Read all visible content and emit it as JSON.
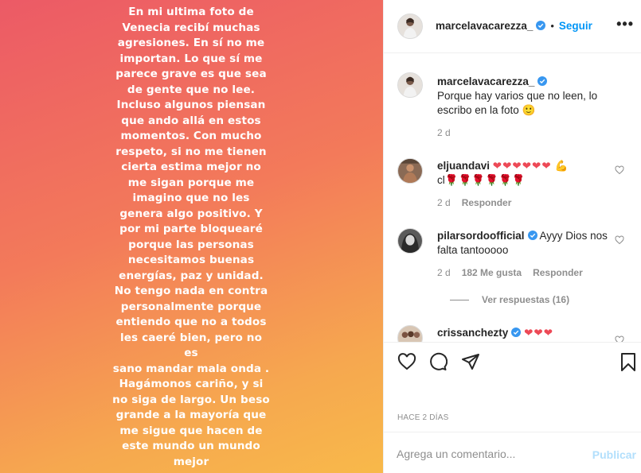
{
  "post": {
    "story_text": "En mi ultima foto de\nVenecia recibí muchas\nagresiones. En sí no me\nimportan. Lo que sí me\nparece grave es que sea\nde gente que no lee.\nIncluso algunos piensan\nque ando allá en estos\nmomentos. Con mucho\nrespeto, si no me tienen\ncierta estima mejor no\nme sigan porque me\nimagino que no les\ngenera algo positivo. Y\npor mi parte bloquearé\nporque las personas\nnecesitamos buenas\nenergías, paz y unidad.\nNo tengo nada en contra\npersonalmente porque\nentiendo que no a todos\nles caeré bien, pero no es\nsano mandar mala onda .\nHagámonos cariño, y si\nno siga de largo. Un beso\ngrande a la mayoría que\nme sigue que hacen de\neste mundo un mundo\nmejor"
  },
  "header": {
    "username": "marcelavacarezza_",
    "dot": "•",
    "follow_label": "Seguir",
    "menu": "•••"
  },
  "caption": {
    "username": "marcelavacarezza_",
    "text": "Porque hay varios que no leen, lo escribo en la foto 🙂",
    "time": "2 d"
  },
  "comments": [
    {
      "username": "eljuandavi",
      "text_hearts": "❤❤❤❤❤❤",
      "text_arm": "💪",
      "text_line2_prefix": "cl",
      "text_line2_roses": "🌹🌹🌹🌹🌹🌹",
      "time": "2 d",
      "reply_label": "Responder"
    },
    {
      "username": "pilarsordoofficial",
      "text": "Ayyy Dios nos falta tantooooo",
      "time": "2 d",
      "likes": "182 Me gusta",
      "reply_label": "Responder",
      "view_replies": "Ver respuestas (16)"
    },
    {
      "username": "crissanchezty",
      "text_hearts": "❤❤❤"
    }
  ],
  "footer": {
    "time_ago": "HACE 2 DÍAS",
    "comment_placeholder": "Agrega un comentario...",
    "publish_label": "Publicar"
  },
  "colors": {
    "accent_blue": "#0095f6",
    "verified_blue": "#3897f0",
    "publish_disabled": "#b2dffc",
    "muted": "#8e8e8e"
  }
}
